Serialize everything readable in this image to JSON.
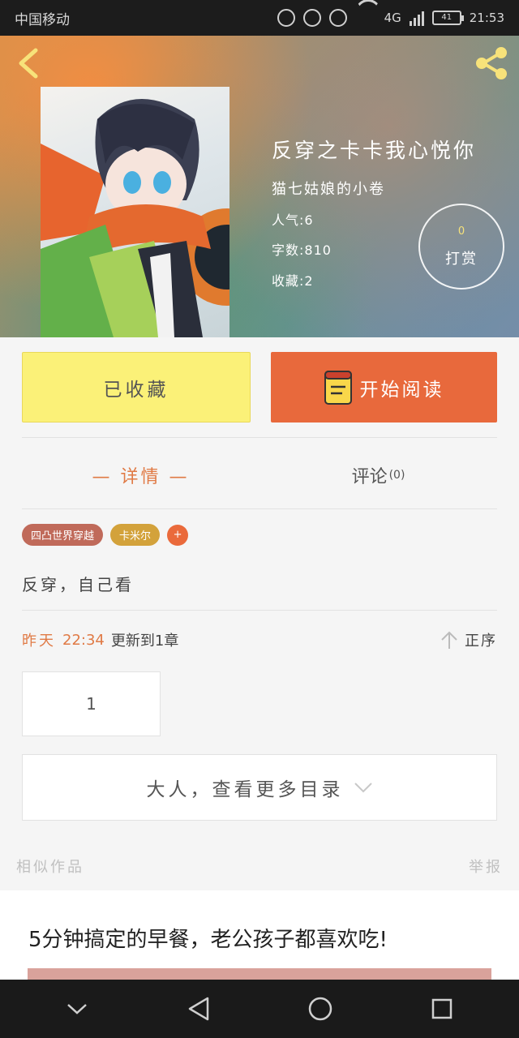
{
  "status_bar": {
    "carrier": "中国移动",
    "network": "4G",
    "battery": "41",
    "time": "21:53"
  },
  "book": {
    "title": "反穿之卡卡我心悦你",
    "author": "猫七姑娘的小卷",
    "popularity": "人气:6",
    "word_count": "字数:810",
    "favorites": "收藏:2"
  },
  "reward": {
    "count": "0",
    "label": "打赏"
  },
  "actions": {
    "collected_label": "已收藏",
    "read_label": "开始阅读"
  },
  "tabs": [
    {
      "label": "— 详情 —"
    },
    {
      "label": "评论",
      "count": "(0)"
    }
  ],
  "tags": [
    "四凸世界穿越",
    "卡米尔"
  ],
  "tag_add": "+",
  "description": "反穿，自己看",
  "update": {
    "day": "昨天",
    "time": "22:34",
    "text": "更新到1章",
    "sort_label": "正序"
  },
  "chapter": "1",
  "more_label": "大人，查看更多目录",
  "similar_label": "相似作品",
  "report_label": "举报",
  "ad": {
    "title": "5分钟搞定的早餐，老公孩子都喜欢吃!"
  },
  "colors": {
    "accent_orange": "#e8693c",
    "collected_yellow": "#fbf178",
    "tab_active": "#e07a45"
  }
}
